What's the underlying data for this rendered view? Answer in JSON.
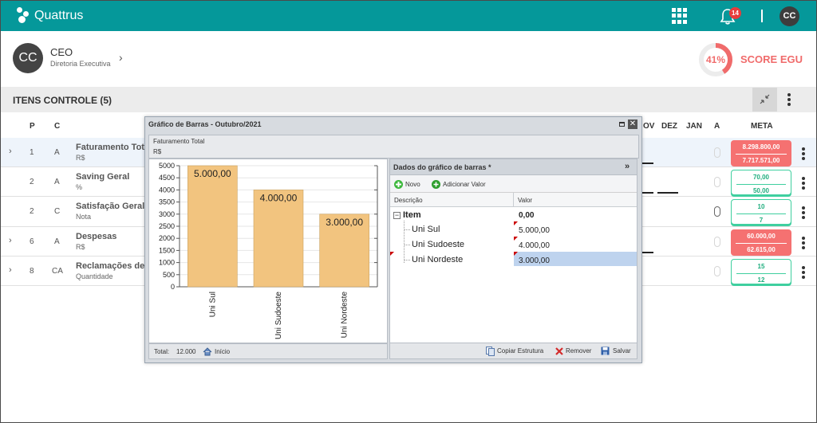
{
  "app": {
    "brand": "Quattrus",
    "notifications_count": "14",
    "user_initials": "CC"
  },
  "profile": {
    "initials": "CC",
    "role": "CEO",
    "department": "Diretoria Executiva"
  },
  "score": {
    "percent_text": "41%",
    "percent": 0.41,
    "label": "SCORE EGU",
    "color": "#f06b6b"
  },
  "section": {
    "title": "ITENS CONTROLE (5)"
  },
  "table": {
    "headers": {
      "p": "P",
      "c": "C",
      "nov": "OV",
      "dez": "DEZ",
      "jan": "JAN",
      "a": "A",
      "meta": "META"
    },
    "rows": [
      {
        "p": "1",
        "c": "A",
        "name": "Faturamento Tota",
        "unit": "R$",
        "meta1": "8.298.800,00",
        "meta2": "7.717.571,00",
        "meta_style": "red"
      },
      {
        "p": "2",
        "c": "A",
        "name": "Saving Geral",
        "unit": "%",
        "meta1": "70,00",
        "meta2": "50,00",
        "meta_style": "green"
      },
      {
        "p": "2",
        "c": "C",
        "name": "Satisfação Geral c",
        "unit": "Nota",
        "meta1": "10",
        "meta2": "7",
        "meta_style": "green"
      },
      {
        "p": "6",
        "c": "A",
        "name": "Despesas",
        "unit": "R$",
        "meta1": "60.000,00",
        "meta2": "62.615,00",
        "meta_style": "red"
      },
      {
        "p": "8",
        "c": "CA",
        "name": "Reclamações de C",
        "unit": "Quantidade",
        "meta1": "15",
        "meta2": "12",
        "meta_style": "green"
      }
    ]
  },
  "dialog": {
    "title": "Gráfico de Barras - Outubro/2021",
    "chart_title": "Faturamento Total",
    "chart_unit": "R$",
    "footer": {
      "total_label": "Total:",
      "total_value": "12.000",
      "home_label": "Início"
    },
    "data_panel": {
      "title": "Dados do gráfico de barras *",
      "new_label": "Novo",
      "add_value_label": "Adicionar Valor",
      "col_desc": "Descrição",
      "col_value": "Valor",
      "root_label": "Item",
      "root_value": "0,00",
      "items": [
        {
          "label": "Uni Sul",
          "value": "5.000,00"
        },
        {
          "label": "Uni Sudoeste",
          "value": "4.000,00"
        },
        {
          "label": "Uni Nordeste",
          "value": "3.000,00"
        }
      ],
      "copy_label": "Copiar Estrutura",
      "remove_label": "Remover",
      "save_label": "Salvar"
    }
  },
  "chart_data": {
    "type": "bar",
    "categories": [
      "Uni Sul",
      "Uni Sudoeste",
      "Uni Nordeste"
    ],
    "values": [
      5000,
      4000,
      3000
    ],
    "data_labels": [
      "5.000,00",
      "4.000,00",
      "3.000,00"
    ],
    "yticks": [
      "0",
      "500",
      "1000",
      "1500",
      "2000",
      "2500",
      "3000",
      "3500",
      "4000",
      "4500",
      "5000"
    ],
    "ylim": [
      0,
      5000
    ],
    "bar_color": "#f2c47f",
    "grid": true
  }
}
